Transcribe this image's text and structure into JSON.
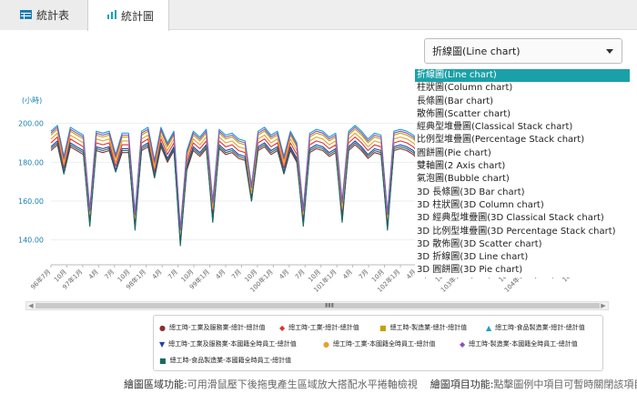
{
  "tabs": [
    {
      "label": "統計表",
      "icon": "table-icon"
    },
    {
      "label": "統計圖",
      "icon": "bar-chart-icon"
    }
  ],
  "chart_type_select": {
    "value": "折線圖(Line chart)"
  },
  "chart_type_options": [
    "折線圖(Line chart)",
    "柱狀圖(Column chart)",
    "長條圖(Bar chart)",
    "散佈圖(Scatter chart)",
    "經典型堆疊圖(Classical Stack chart)",
    "比例型堆疊圖(Percentage Stack chart)",
    "圓餅圖(Pie chart)",
    "雙軸圖(2 Axis chart)",
    "氣泡圖(Bubble chart)",
    "3D 長條圖(3D Bar chart)",
    "3D 柱狀圖(3D Column chart)",
    "3D 經典型堆疊圖(3D Classical Stack chart)",
    "3D 比例型堆疊圖(3D Percentage Stack chart)",
    "3D 散佈圖(3D Scatter chart)",
    "3D 折線圖(3D Line chart)",
    "3D 圓餅圖(3D Pie chart)"
  ],
  "legend_items": [
    {
      "label": "總工時-工業及服務業-總計-總計值",
      "color": "#8b2e2e",
      "marker": "●"
    },
    {
      "label": "總工時-工業-總計-總計值",
      "color": "#e03030",
      "marker": "◆"
    },
    {
      "label": "總工時-製造業-總計-總計值",
      "color": "#c8a000",
      "marker": "■"
    },
    {
      "label": "總工時-食品製造業-總計-總計值",
      "color": "#1aa1c8",
      "marker": "▲"
    },
    {
      "label": "總工時-工業及服務業-本國籍全時員工-總計值",
      "color": "#2040b0",
      "marker": "▼"
    },
    {
      "label": "總工時-工業-本國籍全時員工-總計值",
      "color": "#e8a030",
      "marker": "●"
    },
    {
      "label": "總工時-製造業-本國籍全時員工-總計值",
      "color": "#8a50c0",
      "marker": "◆"
    },
    {
      "label": "總工時-食品製造業-本國籍全時員工-總計值",
      "color": "#1a6a60",
      "marker": "■"
    }
  ],
  "footer": {
    "part1_label": "繪圖區域功能:",
    "part1_text": "可用滑鼠壓下後拖曳產生區域放大搭配水平捲軸檢視",
    "part2_label": "繪圖項目功能:",
    "part2_text": "點擊圖例中項目可暫時關閉該項目"
  },
  "chart_data": {
    "type": "line",
    "ylabel": "(小時)",
    "yticks": [
      "200.00",
      "180.00",
      "160.00",
      "140.00"
    ],
    "ylim": [
      130,
      205
    ],
    "xtick_labels": [
      "96年7月",
      "10月",
      "97年1月",
      "4月",
      "7月",
      "10月",
      "98年1月",
      "4月",
      "7月",
      "10月",
      "99年1月",
      "4月",
      "7月",
      "10月",
      "100年1月",
      "4月",
      "7月",
      "10月",
      "101年1月",
      "4月",
      "7月",
      "10月",
      "102年1月",
      "4月",
      "7月",
      "10月",
      "103年1月",
      "4月",
      "7月",
      "10月",
      "104年1月",
      "4月",
      "7月",
      "10月"
    ],
    "series": [
      {
        "name": "總工時-工業及服務業-總計-總計值",
        "color": "#8b2e2e",
        "values": [
          186,
          189,
          174,
          188,
          186,
          184,
          150,
          186,
          185,
          186,
          175,
          185,
          185,
          148,
          186,
          188,
          172,
          188,
          180,
          186,
          140,
          176,
          186,
          183,
          187,
          152,
          187,
          184,
          185,
          182,
          181,
          160,
          186,
          188,
          184,
          186,
          174,
          186,
          180,
          150,
          185,
          187,
          186,
          183,
          185,
          152,
          186,
          189,
          186,
          182,
          185,
          184,
          148,
          186,
          187,
          186,
          184,
          180,
          174,
          186,
          188,
          138,
          186,
          187,
          178,
          185,
          186,
          188,
          176,
          186,
          182,
          150,
          186,
          184,
          188,
          182,
          186,
          176,
          184,
          186,
          182,
          187
        ]
      },
      {
        "name": "總工時-工業-總計-總計值",
        "color": "#e03030",
        "values": [
          190,
          193,
          177,
          192,
          190,
          188,
          152,
          190,
          189,
          190,
          178,
          189,
          189,
          150,
          190,
          192,
          175,
          192,
          184,
          190,
          142,
          180,
          190,
          187,
          191,
          155,
          191,
          188,
          189,
          186,
          185,
          163,
          190,
          192,
          188,
          190,
          177,
          190,
          184,
          152,
          189,
          191,
          190,
          187,
          189,
          155,
          190,
          193,
          190,
          186,
          189,
          188,
          150,
          190,
          191,
          190,
          188,
          184,
          177,
          190,
          192,
          140,
          190,
          191,
          182,
          189,
          190,
          192,
          180,
          190,
          186,
          153,
          190,
          188,
          192,
          186,
          190,
          180,
          188,
          190,
          186,
          191
        ]
      },
      {
        "name": "總工時-製造業-總計-總計值",
        "color": "#c8a000",
        "values": [
          194,
          197,
          181,
          196,
          194,
          192,
          154,
          194,
          193,
          194,
          182,
          193,
          193,
          152,
          194,
          196,
          179,
          196,
          188,
          194,
          144,
          184,
          194,
          191,
          195,
          158,
          195,
          192,
          193,
          190,
          189,
          166,
          194,
          196,
          192,
          194,
          181,
          194,
          188,
          154,
          193,
          195,
          194,
          191,
          193,
          158,
          194,
          197,
          194,
          190,
          193,
          192,
          152,
          194,
          195,
          194,
          192,
          188,
          181,
          194,
          196,
          142,
          194,
          195,
          186,
          193,
          194,
          196,
          184,
          194,
          190,
          156,
          194,
          192,
          196,
          190,
          194,
          184,
          192,
          194,
          190,
          195
        ]
      },
      {
        "name": "總工時-食品製造業-總計-總計值",
        "color": "#1aa1c8",
        "values": [
          196,
          199,
          183,
          198,
          196,
          194,
          156,
          196,
          195,
          196,
          184,
          195,
          195,
          154,
          196,
          198,
          181,
          198,
          190,
          196,
          146,
          186,
          196,
          193,
          197,
          160,
          197,
          194,
          195,
          192,
          191,
          168,
          196,
          198,
          194,
          196,
          183,
          196,
          190,
          156,
          195,
          197,
          196,
          193,
          195,
          160,
          196,
          199,
          196,
          192,
          195,
          194,
          154,
          196,
          197,
          196,
          194,
          190,
          183,
          196,
          198,
          144,
          196,
          197,
          188,
          195,
          196,
          198,
          186,
          196,
          192,
          158,
          196,
          194,
          198,
          192,
          196,
          186,
          194,
          196,
          192,
          197
        ]
      },
      {
        "name": "總工時-工業及服務業-本國籍全時員工-總計值",
        "color": "#2040b0",
        "values": [
          188,
          191,
          175,
          190,
          188,
          186,
          148,
          188,
          187,
          188,
          176,
          187,
          187,
          146,
          188,
          190,
          173,
          190,
          182,
          188,
          138,
          178,
          188,
          185,
          189,
          150,
          189,
          186,
          187,
          184,
          183,
          161,
          188,
          190,
          186,
          188,
          175,
          188,
          182,
          148,
          187,
          189,
          188,
          185,
          187,
          150,
          188,
          191,
          188,
          184,
          187,
          186,
          146,
          188,
          189,
          188,
          186,
          182,
          175,
          188,
          190,
          136,
          188,
          189,
          180,
          187,
          188,
          190,
          178,
          188,
          184,
          148,
          188,
          186,
          190,
          184,
          188,
          178,
          186,
          188,
          184,
          189
        ]
      },
      {
        "name": "總工時-工業-本國籍全時員工-總計值",
        "color": "#e8a030",
        "values": [
          192,
          195,
          179,
          194,
          192,
          190,
          153,
          192,
          191,
          192,
          180,
          191,
          191,
          151,
          192,
          194,
          177,
          194,
          186,
          192,
          143,
          182,
          192,
          189,
          193,
          156,
          193,
          190,
          191,
          188,
          187,
          164,
          192,
          194,
          190,
          192,
          179,
          192,
          186,
          153,
          191,
          193,
          192,
          189,
          191,
          156,
          192,
          195,
          192,
          188,
          191,
          190,
          151,
          192,
          193,
          192,
          190,
          186,
          179,
          192,
          194,
          141,
          192,
          193,
          184,
          191,
          192,
          194,
          182,
          192,
          188,
          154,
          192,
          190,
          194,
          188,
          192,
          182,
          190,
          192,
          188,
          193
        ]
      },
      {
        "name": "總工時-製造業-本國籍全時員工-總計值",
        "color": "#8a50c0",
        "values": [
          195,
          198,
          182,
          197,
          195,
          193,
          155,
          195,
          194,
          195,
          183,
          194,
          194,
          153,
          195,
          197,
          180,
          197,
          189,
          195,
          145,
          185,
          195,
          192,
          196,
          159,
          196,
          193,
          194,
          191,
          190,
          167,
          195,
          197,
          193,
          195,
          182,
          195,
          189,
          155,
          194,
          196,
          195,
          192,
          194,
          159,
          195,
          198,
          195,
          191,
          194,
          193,
          153,
          195,
          196,
          195,
          193,
          189,
          182,
          195,
          197,
          143,
          195,
          196,
          187,
          194,
          195,
          197,
          185,
          195,
          191,
          157,
          195,
          193,
          197,
          191,
          195,
          185,
          193,
          195,
          191,
          196
        ]
      },
      {
        "name": "總工時-食品製造業-本國籍全時員工-總計值",
        "color": "#1a6a60",
        "values": [
          187,
          190,
          174,
          189,
          187,
          185,
          147,
          187,
          186,
          187,
          175,
          186,
          186,
          145,
          187,
          189,
          172,
          189,
          181,
          187,
          137,
          177,
          187,
          184,
          188,
          149,
          188,
          185,
          186,
          183,
          182,
          160,
          187,
          189,
          185,
          187,
          174,
          187,
          181,
          147,
          186,
          188,
          187,
          184,
          186,
          149,
          187,
          190,
          187,
          183,
          186,
          185,
          145,
          187,
          188,
          187,
          185,
          181,
          174,
          187,
          189,
          135,
          187,
          188,
          179,
          186,
          187,
          189,
          177,
          187,
          183,
          147,
          187,
          185,
          189,
          183,
          187,
          177,
          185,
          187,
          183,
          188
        ]
      }
    ]
  }
}
